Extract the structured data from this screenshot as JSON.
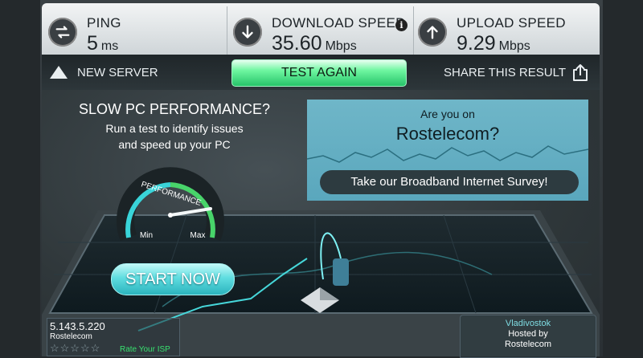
{
  "metrics": {
    "ping": {
      "label": "PING",
      "value": "5",
      "unit": "ms"
    },
    "download": {
      "label": "DOWNLOAD SPEED",
      "value": "35.60",
      "unit": "Mbps",
      "info_icon": "i"
    },
    "upload": {
      "label": "UPLOAD SPEED",
      "value": "9.29",
      "unit": "Mbps"
    }
  },
  "actions": {
    "new_server": "NEW SERVER",
    "test_again": "TEST AGAIN",
    "share": "SHARE THIS RESULT"
  },
  "promo": {
    "title": "SLOW PC PERFORMANCE?",
    "line1": "Run a test to identify issues",
    "line2": "and speed up your PC",
    "gauge_label": "PERFORMANCE",
    "gauge_min": "Min",
    "gauge_max": "Max",
    "start": "START NOW"
  },
  "survey": {
    "question": "Are you on",
    "isp": "Rostelecom?",
    "button": "Take our Broadband Internet Survey!"
  },
  "client": {
    "ip": "5.143.5.220",
    "isp": "Rostelecom",
    "stars": "☆☆☆☆☆",
    "rate": "Rate Your ISP"
  },
  "server": {
    "city": "Vladivostok",
    "hosted_by": "Hosted by",
    "host": "Rostelecom"
  },
  "colors": {
    "accent_green": "#27c46a",
    "accent_cyan": "#5fdde0",
    "survey_blue": "#6fb6c8"
  }
}
